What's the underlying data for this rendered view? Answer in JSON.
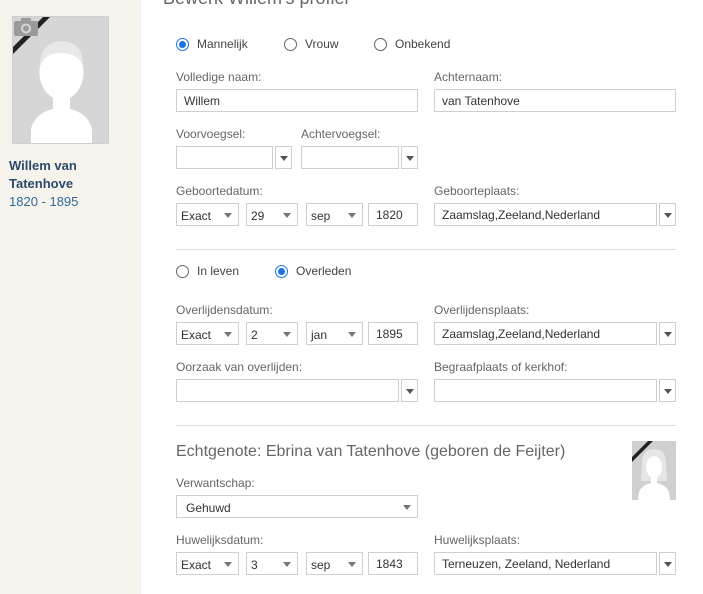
{
  "sidebar": {
    "person_name": "Willem van Tatenhove",
    "person_years": "1820 - 1895"
  },
  "page": {
    "title": "Bewerk Willem's profiel"
  },
  "gender": {
    "options": [
      "Mannelijk",
      "Vrouw",
      "Onbekend"
    ],
    "selected": "Mannelijk"
  },
  "name": {
    "full_name_label": "Volledige naam:",
    "full_name_value": "Willem",
    "last_name_label": "Achternaam:",
    "last_name_value": "van Tatenhove",
    "prefix_label": "Voorvoegsel:",
    "prefix_value": "",
    "suffix_label": "Achtervoegsel:",
    "suffix_value": ""
  },
  "birth": {
    "date_label": "Geboortedatum:",
    "precision": "Exact",
    "day": "29",
    "month": "sep",
    "year": "1820",
    "place_label": "Geboorteplaats:",
    "place_value": "Zaamslag,Zeeland,Nederland"
  },
  "status": {
    "options": [
      "In leven",
      "Overleden"
    ],
    "selected": "Overleden"
  },
  "death": {
    "date_label": "Overlijdensdatum:",
    "precision": "Exact",
    "day": "2",
    "month": "jan",
    "year": "1895",
    "place_label": "Overlijdensplaats:",
    "place_value": "Zaamslag,Zeeland,Nederland",
    "cause_label": "Oorzaak van overlijden:",
    "cause_value": "",
    "burial_label": "Begraafplaats of kerkhof:",
    "burial_value": ""
  },
  "spouse": {
    "title": "Echtgenote: Ebrina van Tatenhove (geboren de Feijter)",
    "relation_label": "Verwantschap:",
    "relation_value": "Gehuwd",
    "marriage_date_label": "Huwelijksdatum:",
    "precision": "Exact",
    "day": "3",
    "month": "sep",
    "year": "1843",
    "marriage_place_label": "Huwelijksplaats:",
    "marriage_place_value": "Terneuzen, Zeeland, Nederland"
  },
  "colors": {
    "accent": "#1a73e8",
    "sidebar_bg": "#f6f3ed",
    "name_color": "#2a4a6b",
    "years_color": "#2f6a9a"
  }
}
